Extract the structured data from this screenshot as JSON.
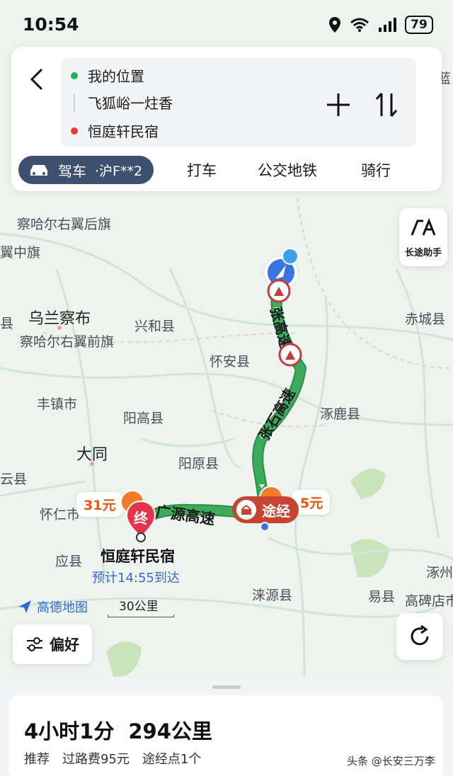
{
  "status_bar": {
    "time": "10:54",
    "battery": "79"
  },
  "route": {
    "origin": "我的位置",
    "waypoint": "飞狐峪一炷香",
    "destination": "恒庭轩民宿"
  },
  "modes": {
    "drive_label": "驾车",
    "plate": "·沪F**2",
    "taxi": "打车",
    "transit": "公交地铁",
    "ride": "骑行"
  },
  "side_button": {
    "long_trip": "长途助手"
  },
  "map_labels": {
    "chahaer_youyi_houqi": "察哈尔右翼后旗",
    "yi_zhongqi": "翼中旗",
    "wulanchabu": "乌兰察布",
    "xinghe": "兴和县",
    "chahaer_youyi_qianqi": "察哈尔右翼前旗",
    "huaian": "怀安县",
    "chicheng": "赤城县",
    "fengzhen": "丰镇市",
    "yanggao": "阳高县",
    "zhuolu": "涿鹿县",
    "datong": "大同",
    "yangyuan": "阳原县",
    "yun": "云县",
    "huairen": "怀仁市",
    "ying": "应县",
    "laiyuan": "涞源县",
    "yi": "易县",
    "zhuozhou": "涿州",
    "gaobeidian": "高碑店市",
    "lan": "蓝",
    "e": "县"
  },
  "road_labels": {
    "zhang_gaosu": "张高速",
    "zhangshi_gaosu": "张石高速",
    "guangyuan_gaosu": "广源高速"
  },
  "markers": {
    "price_left": "31元",
    "price_right": "5元",
    "dest_badge": "终",
    "dest_name": "恒庭轩民宿",
    "eta": "预计14:55到达",
    "via": "途经"
  },
  "map_ui": {
    "logo": "高德地图",
    "scale": "30公里",
    "preference": "偏好"
  },
  "summary": {
    "duration": "4小时1分",
    "distance": "294公里",
    "tag": "推荐",
    "toll": "过路费95元",
    "waypoints": "途经点1个"
  },
  "watermark": "头条 @长安三万李",
  "colors": {
    "route_green": "#3daa5c",
    "drive_pill": "#3d5070",
    "link_blue": "#2a6bd6",
    "price_orange": "#e8550c"
  }
}
